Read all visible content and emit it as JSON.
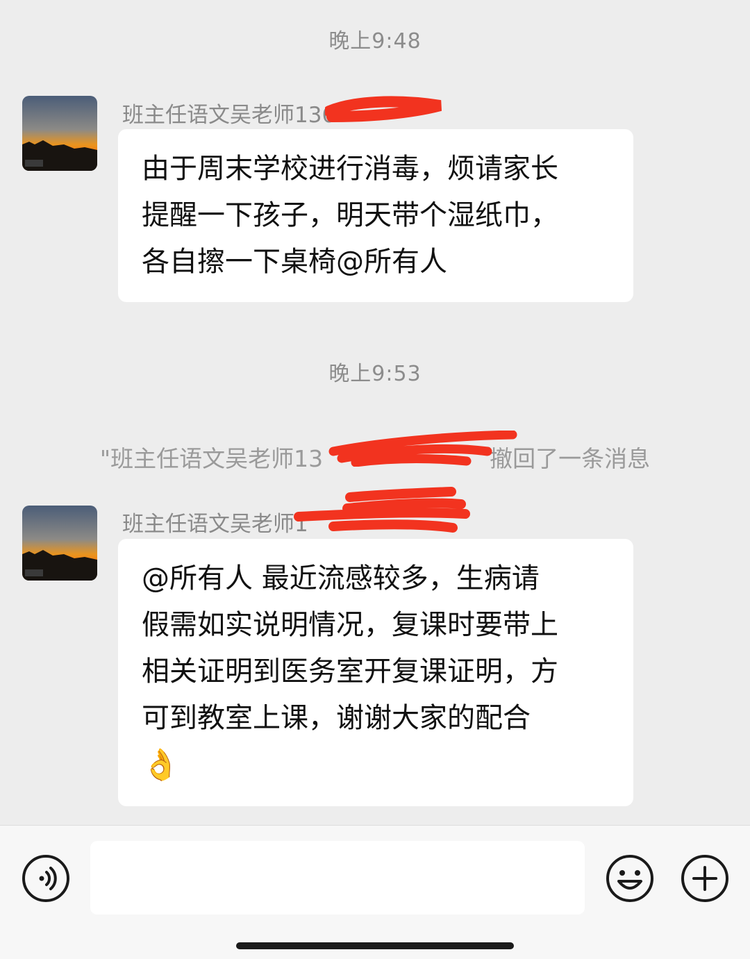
{
  "chat": {
    "messages": [
      {
        "time": "晚上9:48",
        "sender": "班主任语文吴老师136",
        "text_lines": [
          "由于周末学校进行消毒，烦请家长",
          "提醒一下孩子，明天带个湿纸巾，",
          "各自擦一下桌椅@所有人"
        ]
      },
      {
        "time": "晚上9:53",
        "recall_prefix": "\"班主任语文吴老师13",
        "recall_suffix": "撤回了一条消息"
      },
      {
        "sender": "班主任语文吴老师1",
        "text_lines": [
          "@所有人  最近流感较多，生病请",
          "假需如实说明情况，复课时要带上",
          "相关证明到医务室开复课证明，方",
          "可到教室上课，谢谢大家的配合"
        ],
        "emoji": "👌"
      }
    ]
  },
  "input_bar": {
    "voice_icon": "voice-icon",
    "emoji_icon": "emoji-face-icon",
    "plus_icon": "plus-circle-icon",
    "placeholder": ""
  },
  "colors": {
    "background": "#ededed",
    "bubble": "#ffffff",
    "redaction": "#f2331f"
  }
}
